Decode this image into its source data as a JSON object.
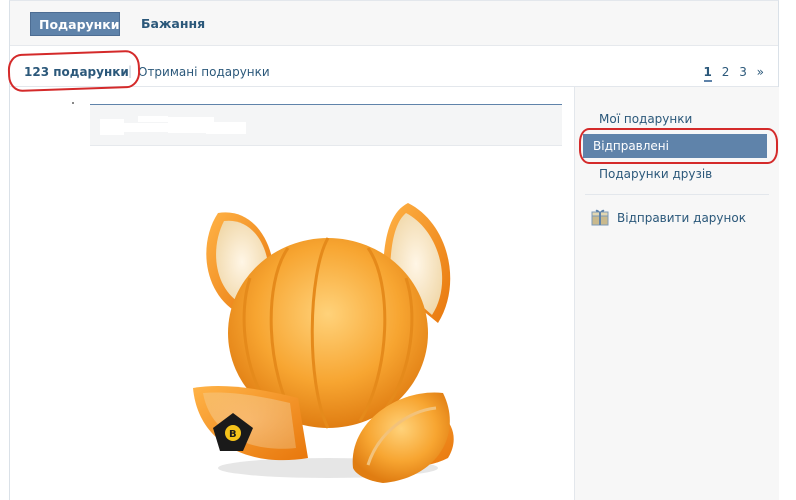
{
  "tabs": {
    "gifts_label": "Подарунки",
    "wishes_label": "Бажання"
  },
  "subnav": {
    "count_label": "123 подарунки",
    "separator": "|",
    "received_label": "Отримані подарунки"
  },
  "pagination": {
    "pages": [
      "1",
      "2",
      "3"
    ],
    "current": "1",
    "next": "»"
  },
  "sidebar": {
    "items": [
      {
        "label": "Мої подарунки",
        "selected": false
      },
      {
        "label": "Відправлені",
        "selected": true
      },
      {
        "label": "Подарунки друзів",
        "selected": false
      }
    ],
    "send_gift_label": "Відправити дарунок"
  },
  "colors": {
    "accent": "#5f83aa",
    "link": "#2b587a",
    "annotation_red": "#d42a2a"
  },
  "icons": [
    "gift-box-icon",
    "tangerine-gift-image"
  ]
}
